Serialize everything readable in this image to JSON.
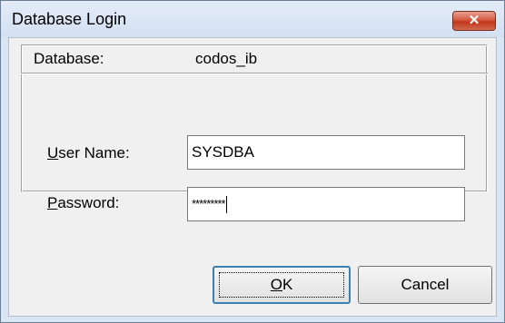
{
  "window": {
    "title": "Database Login",
    "close_glyph": "✕"
  },
  "database": {
    "label": "Database:",
    "value": "codos_ib"
  },
  "username": {
    "label_prefix": "U",
    "label_rest": "ser Name:",
    "value": "SYSDBA"
  },
  "password": {
    "label_prefix": "P",
    "label_rest": "assword:",
    "value": "*********"
  },
  "buttons": {
    "ok_prefix": "O",
    "ok_rest": "K",
    "cancel": "Cancel"
  },
  "colors": {
    "accent": "#3c7fb1",
    "close": "#c2351c"
  }
}
